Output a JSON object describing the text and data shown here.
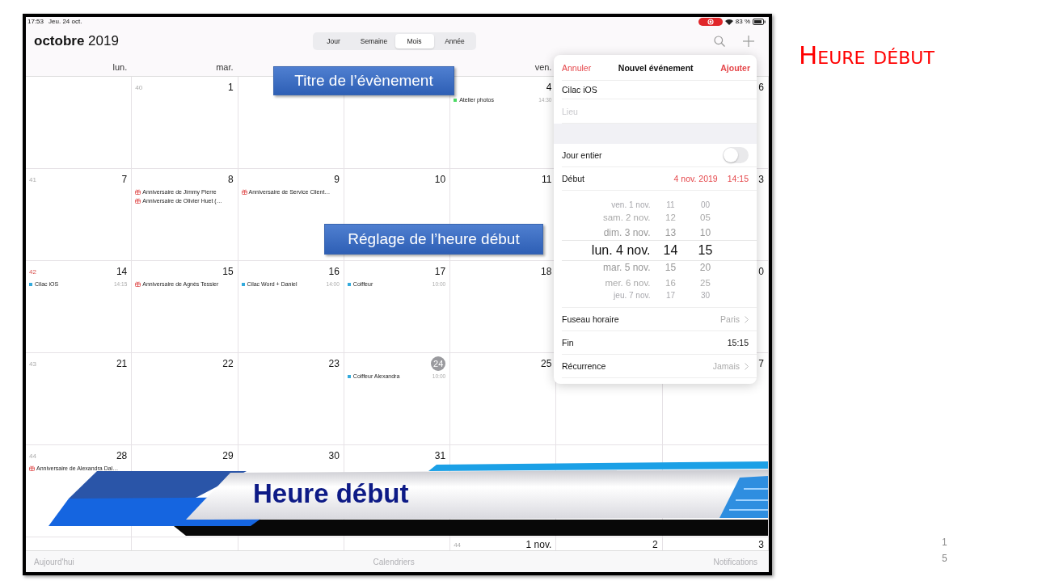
{
  "slide": {
    "title": "Heure début",
    "page_number": "15"
  },
  "status_bar": {
    "time": "17:53",
    "date": "Jeu. 24 oct.",
    "battery": "83 %"
  },
  "header": {
    "month": "**octobre** 2019"
  },
  "view_tabs": [
    {
      "label": "Jour",
      "selected": false
    },
    {
      "label": "Semaine",
      "selected": false
    },
    {
      "label": "Mois",
      "selected": true
    },
    {
      "label": "Année",
      "selected": false
    }
  ],
  "weekday_headers": [
    "lun.",
    "mar.",
    "ven."
  ],
  "weeks": [
    {
      "cells": [
        {},
        {
          "week": "40",
          "week_highlight": false,
          "day": "1",
          "today": false
        },
        {},
        {},
        {
          "day": "4",
          "today": false,
          "events": [
            {
              "kind": "event",
              "title": "Atelier photos",
              "time": "14:30",
              "color": "#4cd964"
            }
          ]
        },
        {},
        {
          "day": "6",
          "today": false
        }
      ]
    },
    {
      "cells": [
        {
          "week": "41",
          "week_highlight": false,
          "day": "7",
          "today": false
        },
        {
          "day": "8",
          "today": false,
          "events": [
            {
              "kind": "birthday",
              "title": "Anniversaire de Jimmy Pierre"
            },
            {
              "kind": "birthday",
              "title": "Anniversaire de Olivier Huet (…"
            }
          ]
        },
        {
          "day": "9",
          "today": false,
          "events": [
            {
              "kind": "birthday",
              "title": "Anniversaire de Service Client…"
            }
          ]
        },
        {
          "day": "10",
          "today": false
        },
        {
          "day": "11",
          "today": false
        },
        {},
        {
          "day": "3",
          "today": false
        }
      ]
    },
    {
      "cells": [
        {
          "week": "42",
          "week_highlight": true,
          "day": "14",
          "today": false,
          "events": [
            {
              "kind": "event",
              "title": "Cilac iOS",
              "time": "14:15",
              "color": "#34aadc"
            }
          ]
        },
        {
          "day": "15",
          "today": false,
          "events": [
            {
              "kind": "birthday",
              "title": "Anniversaire de Agnès Tessier"
            }
          ]
        },
        {
          "day": "16",
          "today": false,
          "events": [
            {
              "kind": "event",
              "title": "Cilac Word + Daniel",
              "time": "14:00",
              "color": "#34aadc"
            }
          ]
        },
        {
          "day": "17",
          "today": false,
          "events": [
            {
              "kind": "event",
              "title": "Coiffeur",
              "time": "10:00",
              "color": "#34aadc"
            }
          ]
        },
        {
          "day": "18",
          "today": false
        },
        {},
        {
          "day": "0",
          "today": false
        }
      ]
    },
    {
      "cells": [
        {
          "week": "43",
          "week_highlight": false,
          "day": "21",
          "today": false
        },
        {
          "day": "22",
          "today": false
        },
        {
          "day": "23",
          "today": false
        },
        {
          "day": "24",
          "today": true,
          "events": [
            {
              "kind": "event",
              "title": "Coiffeur Alexandra",
              "time": "10:00",
              "color": "#34aadc"
            }
          ]
        },
        {
          "day": "25",
          "today": false
        },
        {},
        {
          "day": "7",
          "today": false
        }
      ]
    },
    {
      "cells": [
        {
          "week": "44",
          "week_highlight": false,
          "day": "28",
          "today": false,
          "events": [
            {
              "kind": "birthday",
              "title": "Anniversaire de Alexandra Dal…"
            }
          ]
        },
        {
          "day": "29",
          "today": false
        },
        {
          "day": "30",
          "today": false
        },
        {
          "day": "31",
          "today": false
        },
        {},
        {},
        {}
      ]
    }
  ],
  "partial_week": {
    "cells": [
      {},
      {},
      {},
      {},
      {
        "week": "44",
        "week_highlight": false,
        "day": "1 nov.",
        "today": false
      },
      {
        "day": "2",
        "today": false
      },
      {
        "day": "3",
        "today": false
      }
    ]
  },
  "toolbar": [
    "Aujourd'hui",
    "Calendriers",
    "Notifications"
  ],
  "event_popover": {
    "cancel": "Annuler",
    "title": "Nouvel événement",
    "add": "Ajouter",
    "title_field": {
      "value": "Cilac iOS"
    },
    "location_field": {
      "placeholder": "Lieu"
    },
    "all_day": {
      "label": "Jour entier",
      "on": false
    },
    "start": {
      "label": "Début",
      "date": "4 nov. 2019",
      "time": "14:15"
    },
    "picker": {
      "columns": [
        {
          "items": [
            {
              "label": "ven. 1 nov.",
              "selected": false
            },
            {
              "label": "sam. 2 nov.",
              "selected": false
            },
            {
              "label": "dim. 3 nov.",
              "selected": false
            },
            {
              "label": "lun. 4 nov.",
              "selected": true
            },
            {
              "label": "mar. 5 nov.",
              "selected": false
            },
            {
              "label": "mer. 6 nov.",
              "selected": false
            },
            {
              "label": "jeu. 7 nov.",
              "selected": false
            }
          ]
        },
        {
          "items": [
            {
              "label": "11",
              "selected": false
            },
            {
              "label": "12",
              "selected": false
            },
            {
              "label": "13",
              "selected": false
            },
            {
              "label": "14",
              "selected": true
            },
            {
              "label": "15",
              "selected": false
            },
            {
              "label": "16",
              "selected": false
            },
            {
              "label": "17",
              "selected": false
            }
          ]
        },
        {
          "items": [
            {
              "label": "00",
              "selected": false
            },
            {
              "label": "05",
              "selected": false
            },
            {
              "label": "10",
              "selected": false
            },
            {
              "label": "15",
              "selected": true
            },
            {
              "label": "20",
              "selected": false
            },
            {
              "label": "25",
              "selected": false
            },
            {
              "label": "30",
              "selected": false
            }
          ]
        }
      ]
    },
    "rows": [
      {
        "label": "Fuseau horaire",
        "value": "Paris",
        "chevron": true
      },
      {
        "label": "Fin",
        "value": "15:15",
        "chevron": false
      },
      {
        "label": "Récurrence",
        "value": "Jamais",
        "chevron": true
      }
    ]
  },
  "callouts": [
    {
      "text": "Titre de l’évènement"
    },
    {
      "text": "Réglage de l’heure début"
    }
  ],
  "banner": {
    "title": "Heure début"
  }
}
